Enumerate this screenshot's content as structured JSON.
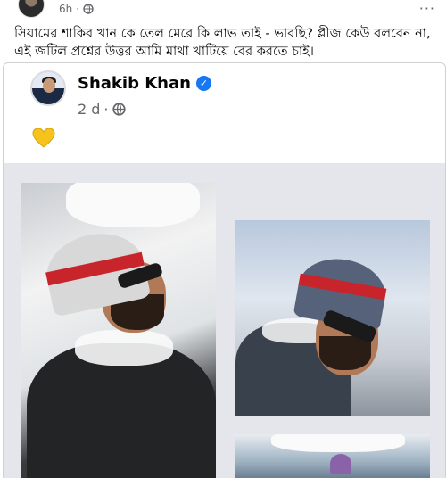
{
  "post": {
    "time": "6h",
    "menu": "···",
    "text": "সিয়ামের শাকিব খান কে তেল মেরে কি লাভ তাই - ভাবছি? প্লীজ কেউ বলবেন না, এই জটিল প্রশ্নের উত্তর আমি মাথা খাটিয়ে বের করতে চাই।",
    "privacy_icon": "globe-icon"
  },
  "shared": {
    "author": "Shakib Khan",
    "verified_icon": "verified-badge-icon",
    "age": "2 d",
    "separator": "·",
    "privacy_icon": "globe-icon",
    "content_icon": "yellow-heart-icon"
  },
  "colors": {
    "verified": "#1877f2",
    "heart": "#f6c21c",
    "meta": "#65676b",
    "photo_bg": "#e4e6eb",
    "hat_stripe": "#c8242c"
  }
}
